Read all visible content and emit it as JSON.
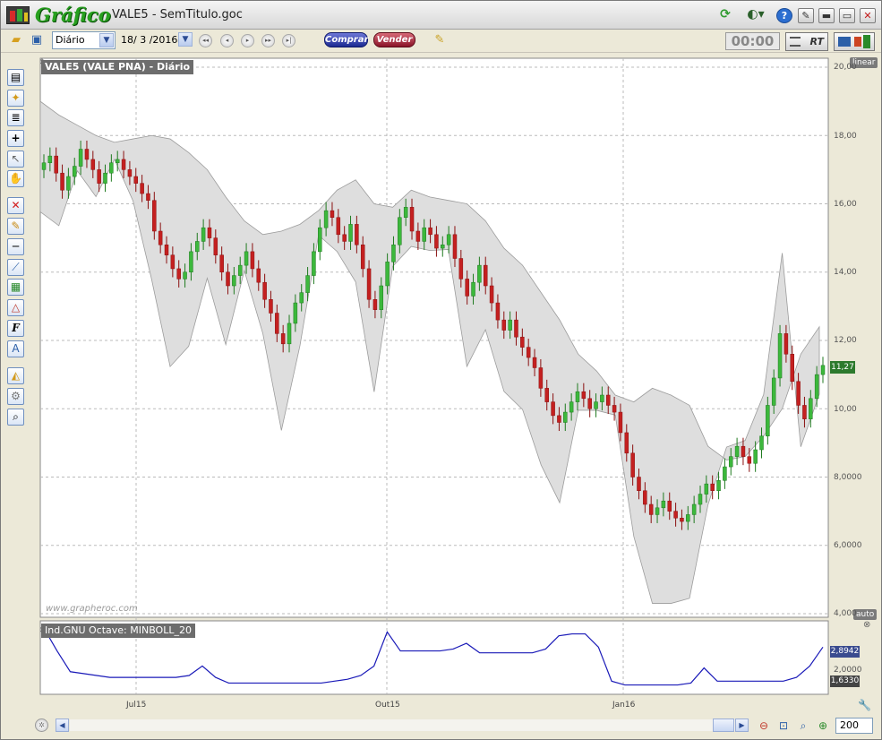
{
  "window": {
    "app_name": "Gráfico",
    "title": "VALE5 - SemTitulo.goc",
    "controls": {
      "minimize": "▬",
      "restore": "▭",
      "close": "✕"
    }
  },
  "toolbar": {
    "period": "Diário",
    "date": "18/ 3 /2016",
    "buy_label": "Comprar",
    "sell_label": "Vender",
    "clock": "00:00",
    "rt_label": "RT"
  },
  "chart": {
    "legend": "VALE5 (VALE        PNA) - Diário",
    "scale_mode": "linear",
    "auto_label": "auto",
    "last_price": "11,27",
    "watermark": "www.grapheroc.com",
    "y_ticks": [
      "20,00",
      "18,00",
      "16,00",
      "14,00",
      "12,00",
      "10,00",
      "8,0000",
      "6,0000",
      "4,000"
    ],
    "x_ticks": [
      "Jul15",
      "Out15",
      "Jan16"
    ]
  },
  "indicator": {
    "legend": "Ind.GNU Octave: MINBOLL_20",
    "value_high": "2,8942",
    "value_low": "1,6330",
    "y_tick": "2,0000"
  },
  "bottom": {
    "zoom": "200"
  },
  "chart_data": {
    "type": "candlestick",
    "title": "VALE5 (VALE        PNA) - Diário",
    "yscale": "linear",
    "ylim": [
      4.0,
      20.0
    ],
    "x_ticks": [
      "Jul15",
      "Out15",
      "Jan16"
    ],
    "series": [
      {
        "name": "VALE5",
        "approx_close": [
          17.2,
          17.4,
          16.9,
          16.4,
          16.8,
          17.1,
          17.6,
          17.3,
          17.0,
          16.6,
          16.9,
          17.2,
          17.3,
          17.0,
          16.8,
          16.6,
          16.3,
          16.1,
          15.2,
          14.8,
          14.5,
          14.1,
          13.8,
          14.0,
          14.6,
          14.9,
          15.3,
          15.0,
          14.5,
          14.0,
          13.6,
          13.9,
          14.2,
          14.6,
          14.1,
          13.7,
          13.2,
          12.8,
          12.2,
          11.9,
          12.5,
          13.1,
          13.4,
          13.9,
          14.6,
          15.3,
          15.8,
          15.6,
          15.1,
          14.9,
          15.4,
          14.8,
          14.1,
          13.2,
          12.9,
          13.6,
          14.3,
          14.8,
          15.6,
          15.9,
          15.2,
          14.9,
          15.3,
          15.1,
          14.7,
          14.8,
          15.1,
          14.4,
          13.8,
          13.3,
          13.7,
          14.2,
          13.6,
          13.1,
          12.6,
          12.3,
          12.6,
          12.1,
          11.8,
          11.5,
          11.2,
          10.6,
          10.2,
          9.8,
          9.6,
          9.9,
          10.2,
          10.5,
          10.3,
          10.0,
          10.2,
          10.4,
          10.1,
          9.9,
          9.3,
          8.7,
          8.0,
          7.6,
          7.2,
          6.9,
          7.1,
          7.3,
          7.0,
          6.8,
          6.7,
          6.9,
          7.2,
          7.5,
          7.8,
          7.6,
          7.9,
          8.3,
          8.6,
          8.9,
          8.6,
          8.4,
          8.8,
          9.2,
          10.1,
          10.9,
          12.2,
          11.6,
          10.8,
          10.1,
          9.7,
          10.3,
          11.0,
          11.27
        ],
        "band_upper_approx": [
          19.0,
          18.6,
          18.3,
          18.0,
          17.8,
          17.9,
          18.0,
          17.9,
          17.5,
          17.0,
          16.2,
          15.5,
          15.1,
          15.2,
          15.4,
          15.8,
          16.4,
          16.7,
          16.0,
          15.9,
          16.4,
          16.2,
          16.1,
          16.0,
          15.5,
          14.7,
          14.2,
          13.4,
          12.6,
          11.6,
          11.1,
          10.4,
          10.2,
          10.6,
          10.4,
          10.1,
          8.9,
          8.5,
          8.6,
          9.2,
          10.0,
          11.6,
          12.4
        ]
      }
    ],
    "indicator": {
      "name": "MINBOLL_20",
      "ylim": [
        1.4,
        3.2
      ],
      "values_approx": [
        3.1,
        2.5,
        1.95,
        1.9,
        1.85,
        1.8,
        1.8,
        1.8,
        1.8,
        1.8,
        1.8,
        1.85,
        2.1,
        1.8,
        1.65,
        1.65,
        1.65,
        1.65,
        1.65,
        1.65,
        1.65,
        1.65,
        1.7,
        1.75,
        1.85,
        2.1,
        3.0,
        2.5,
        2.5,
        2.5,
        2.5,
        2.55,
        2.7,
        2.45,
        2.45,
        2.45,
        2.45,
        2.45,
        2.55,
        2.9,
        2.95,
        2.95,
        2.6,
        1.7,
        1.6,
        1.6,
        1.6,
        1.6,
        1.6,
        1.65,
        2.05,
        1.7,
        1.7,
        1.7,
        1.7,
        1.7,
        1.7,
        1.8,
        2.1,
        2.6
      ]
    }
  }
}
